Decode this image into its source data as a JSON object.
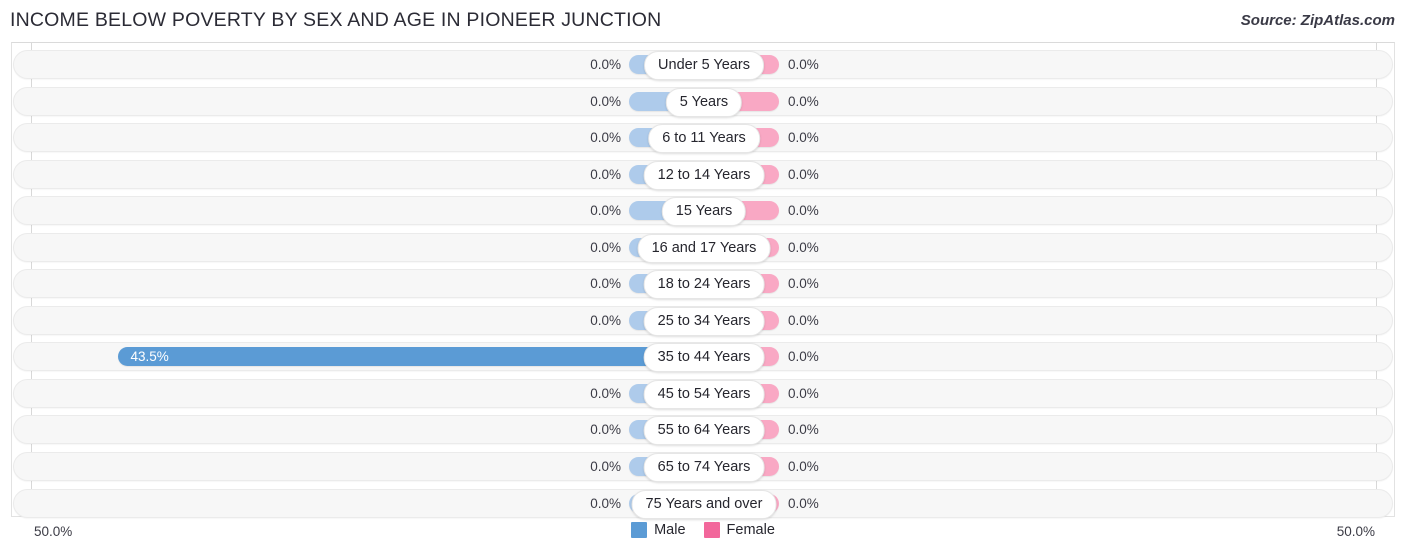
{
  "header": {
    "title": "INCOME BELOW POVERTY BY SEX AND AGE IN PIONEER JUNCTION",
    "source": "Source: ZipAtlas.com"
  },
  "axis": {
    "left_label": "50.0%",
    "right_label": "50.0%"
  },
  "legend": {
    "items": [
      {
        "label": "Male",
        "color": "#5b9bd5"
      },
      {
        "label": "Female",
        "color": "#f2679b"
      }
    ]
  },
  "colors": {
    "male_bar": "#aecbeb",
    "male_bar_highlight": "#5b9bd5",
    "female_bar": "#f9a8c4",
    "female_bar_highlight": "#f2679b",
    "track": "#f7f7f7",
    "axis_line": "#d8d8d8"
  },
  "chart_data": {
    "type": "bar",
    "orientation": "horizontal-diverging",
    "title": "INCOME BELOW POVERTY BY SEX AND AGE IN PIONEER JUNCTION",
    "xlabel": "",
    "ylabel": "",
    "xlim": [
      -50.0,
      50.0
    ],
    "axis_tick_labels": [
      "50.0%",
      "50.0%"
    ],
    "grid": false,
    "legend_position": "bottom-center",
    "categories": [
      "Under 5 Years",
      "5 Years",
      "6 to 11 Years",
      "12 to 14 Years",
      "15 Years",
      "16 and 17 Years",
      "18 to 24 Years",
      "25 to 34 Years",
      "35 to 44 Years",
      "45 to 54 Years",
      "55 to 64 Years",
      "65 to 74 Years",
      "75 Years and over"
    ],
    "series": [
      {
        "name": "Male",
        "values": [
          0.0,
          0.0,
          0.0,
          0.0,
          0.0,
          0.0,
          0.0,
          0.0,
          43.5,
          0.0,
          0.0,
          0.0,
          0.0
        ],
        "labels": [
          "0.0%",
          "0.0%",
          "0.0%",
          "0.0%",
          "0.0%",
          "0.0%",
          "0.0%",
          "0.0%",
          "43.5%",
          "0.0%",
          "0.0%",
          "0.0%",
          "0.0%"
        ]
      },
      {
        "name": "Female",
        "values": [
          0.0,
          0.0,
          0.0,
          0.0,
          0.0,
          0.0,
          0.0,
          0.0,
          0.0,
          0.0,
          0.0,
          0.0,
          0.0
        ],
        "labels": [
          "0.0%",
          "0.0%",
          "0.0%",
          "0.0%",
          "0.0%",
          "0.0%",
          "0.0%",
          "0.0%",
          "0.0%",
          "0.0%",
          "0.0%",
          "0.0%",
          "0.0%"
        ]
      }
    ]
  }
}
